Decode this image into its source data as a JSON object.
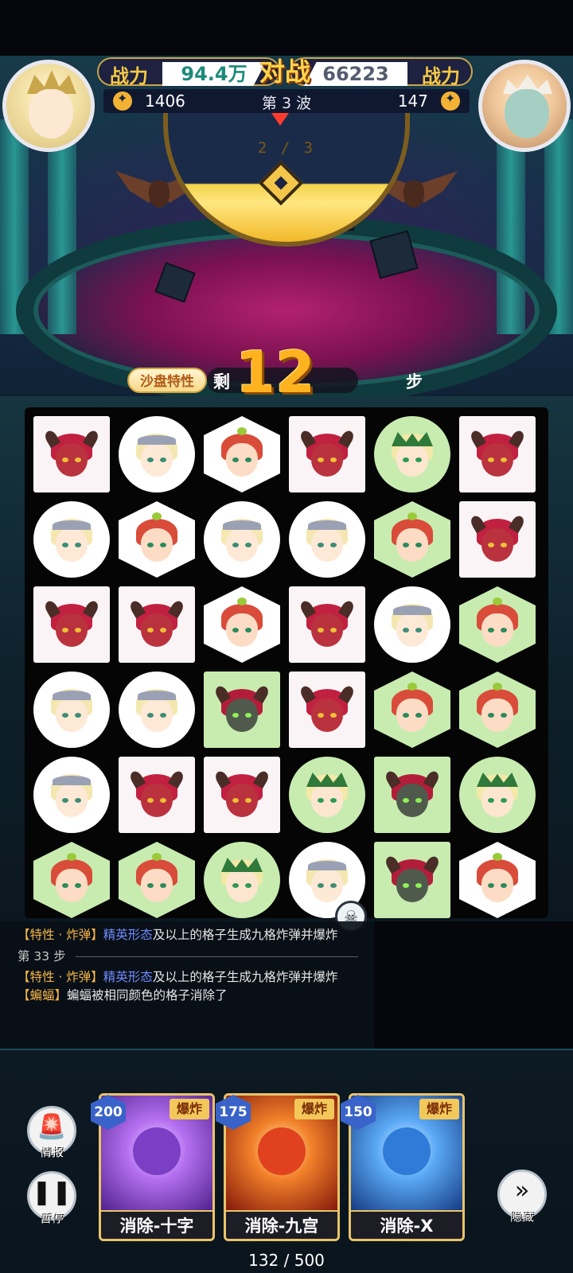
{
  "header": {
    "left_power_label": "战力",
    "left_power_value": "94.4万",
    "vs_label": "对战",
    "right_power_value": "66223",
    "right_power_label": "战力",
    "left_score": "1406",
    "wave_label": "第 3 波",
    "right_score": "147",
    "wave_progress": "2 / 3"
  },
  "steps": {
    "trait_button": "沙盘特性",
    "remain_prefix": "剩",
    "remain_count": "12",
    "remain_suffix": "步"
  },
  "board": {
    "rows": 6,
    "cols": 6,
    "tiles": [
      [
        "demon-square",
        "blonde-circle",
        "red-hex",
        "demon-square",
        "leaf-circle",
        "demon-square"
      ],
      [
        "blonde-circle",
        "red-hex",
        "blonde-circle",
        "blonde-circle",
        "red-hex-green",
        "demon-square"
      ],
      [
        "demon-square",
        "demon-square",
        "red-hex",
        "demon-square",
        "blonde-circle",
        "red-hex-green"
      ],
      [
        "blonde-circle",
        "blonde-circle",
        "orc-square-green",
        "demon-square",
        "red-hex-green",
        "red-hex-green"
      ],
      [
        "blonde-circle",
        "demon-square",
        "demon-square",
        "leaf-circle",
        "orc-square-green",
        "leaf-circle"
      ],
      [
        "red-hex-green",
        "red-hex-green",
        "leaf-circle",
        "blonde-circle",
        "orc-square-green",
        "red-hex"
      ]
    ],
    "bomb_badge_icon": "bomb-icon"
  },
  "log": {
    "line1_tag": "【特性 · 炸弹】",
    "line1_highlight": "精英形态",
    "line1_text": "及以上的格子生成九格炸弹并爆炸",
    "step_label": "第 33 步",
    "line2_tag": "【特性 · 炸弹】",
    "line2_highlight": "精英形态",
    "line2_text": "及以上的格子生成九格炸弹并爆炸",
    "line3_tag": "【蝙蝠】",
    "line3_text": "蝙蝠被相同颜色的格子消除了"
  },
  "controls": {
    "info_label": "情报",
    "pause_label": "暂停",
    "hide_label": "隐藏"
  },
  "cards": [
    {
      "cost": "200",
      "tag": "爆炸",
      "name": "消除-十字",
      "color": "#7a3fc4"
    },
    {
      "cost": "175",
      "tag": "爆炸",
      "name": "消除-九宫",
      "color": "#e0421f"
    },
    {
      "cost": "150",
      "tag": "爆炸",
      "name": "消除-X",
      "color": "#2f7bd8"
    }
  ],
  "energy": {
    "current": "132",
    "max": "500",
    "text": "132 / 500"
  },
  "colors": {
    "accent_gold": "#f6c945",
    "power_teal": "#1c8a7b",
    "log_tag": "#f3b64a",
    "log_highlight": "#6e8cff"
  }
}
